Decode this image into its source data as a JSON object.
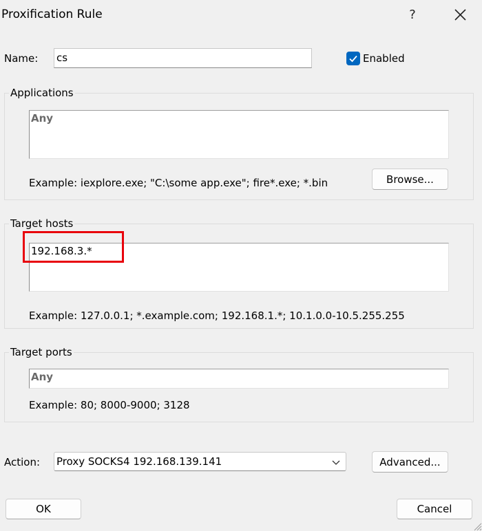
{
  "window": {
    "title": "Proxification Rule",
    "help_label": "?"
  },
  "name": {
    "label": "Name:",
    "value": "cs",
    "enabled_label": "Enabled"
  },
  "applications": {
    "group_label": "Applications",
    "value": "Any",
    "example": "Example: iexplore.exe; \"C:\\some app.exe\"; fire*.exe; *.bin",
    "browse_label": "Browse..."
  },
  "target_hosts": {
    "group_label": "Target hosts",
    "value": "192.168.3.*",
    "example": "Example: 127.0.0.1; *.example.com; 192.168.1.*; 10.1.0.0-10.5.255.255"
  },
  "target_ports": {
    "group_label": "Target ports",
    "value": "Any",
    "example": "Example: 80; 8000-9000; 3128"
  },
  "action": {
    "label": "Action:",
    "selected": "Proxy SOCKS4 192.168.139.141",
    "advanced_label": "Advanced..."
  },
  "footer": {
    "ok_label": "OK",
    "cancel_label": "Cancel"
  },
  "colors": {
    "accent": "#0067c0",
    "highlight": "#e8000b"
  }
}
